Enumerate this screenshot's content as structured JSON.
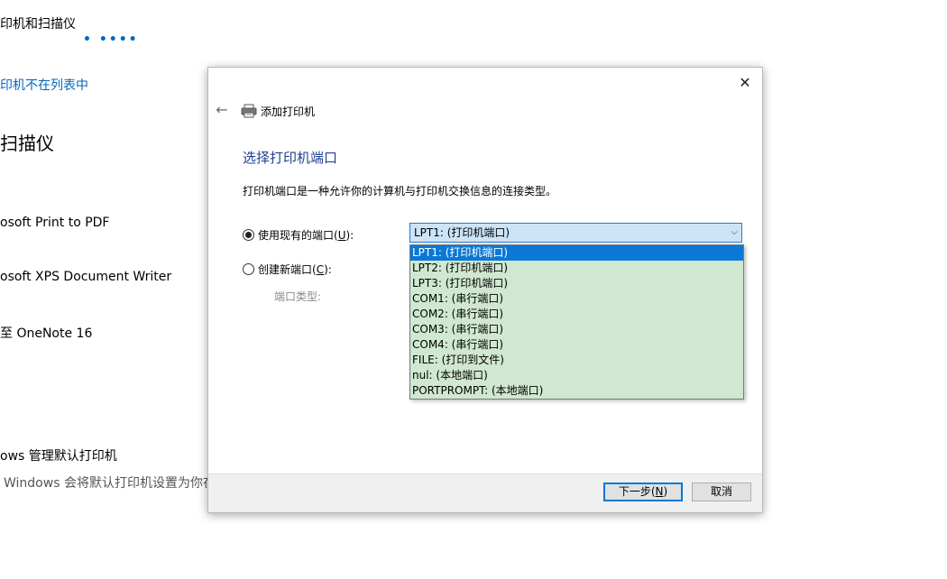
{
  "background": {
    "title": "印机和扫描仪",
    "dots": "• ••••",
    "link": "印机不在列表中",
    "heading": "扫描仪",
    "printers": [
      "osoft Print to PDF",
      "osoft XPS Document Writer",
      "至 OneNote 16"
    ],
    "manage_label": "ows 管理默认打印机",
    "manage_desc": "Windows 会将默认打印机设置为你在"
  },
  "dialog": {
    "close_glyph": "✕",
    "back_glyph": "←",
    "title": "添加打印机",
    "heading": "选择打印机端口",
    "description": "打印机端口是一种允许你的计算机与打印机交换信息的连接类型。",
    "use_existing_label": "使用现有的端口(",
    "use_existing_key": "U",
    "use_existing_suffix": "):",
    "create_new_label": "创建新端口(",
    "create_new_key": "C",
    "create_new_suffix": "):",
    "port_type_label": "端口类型:",
    "selected_port": "LPT1: (打印机端口)",
    "port_options": [
      "LPT1: (打印机端口)",
      "LPT2: (打印机端口)",
      "LPT3: (打印机端口)",
      "COM1: (串行端口)",
      "COM2: (串行端口)",
      "COM3: (串行端口)",
      "COM4: (串行端口)",
      "FILE: (打印到文件)",
      "nul: (本地端口)",
      "PORTPROMPT: (本地端口)"
    ],
    "next_label": "下一步(",
    "next_key": "N",
    "next_suffix": ")",
    "cancel_label": "取消"
  },
  "colors": {
    "accent": "#0078d7",
    "heading": "#1f3f8f",
    "listbox_bg": "#cfe8cf",
    "selected_bg": "#0a78d4"
  }
}
